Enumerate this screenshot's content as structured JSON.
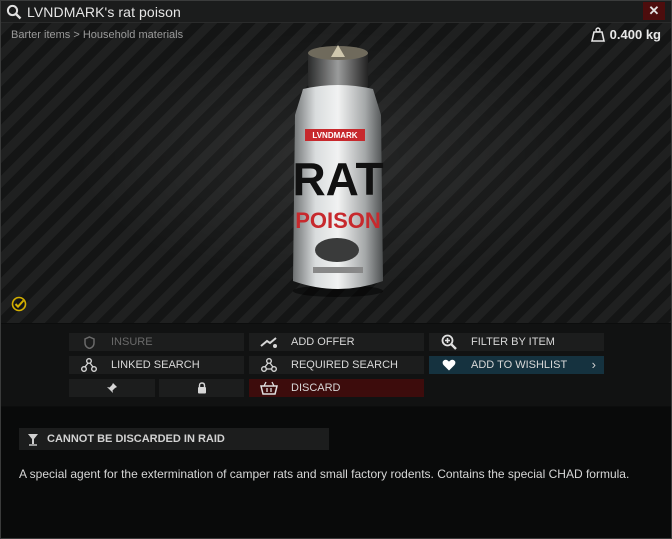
{
  "window": {
    "title": "LVNDMARK's rat poison",
    "close_label": "✕"
  },
  "viewer": {
    "breadcrumb": "Barter items > Household materials",
    "weight": "0.400 kg",
    "product": {
      "brand": "LVNDMARK",
      "line1": "RAT",
      "line2": "POISON"
    }
  },
  "actions": {
    "insure": "INSURE",
    "add_offer": "ADD OFFER",
    "filter_by_item": "FILTER BY ITEM",
    "linked_search": "LINKED SEARCH",
    "required_search": "REQUIRED SEARCH",
    "add_to_wishlist": "ADD TO WISHLIST",
    "discard": "DISCARD",
    "wishlist_chevron": "›"
  },
  "info": {
    "warning": "CANNOT BE DISCARDED IN RAID",
    "description": "A special agent for the extermination of camper rats and small factory rodents. Contains the special CHAD formula."
  },
  "colors": {
    "wishlist_bg": "#15323f",
    "discard_bg": "#3d0c0c",
    "close_bg": "#4d0d0d",
    "check_icon": "#d4b000"
  }
}
